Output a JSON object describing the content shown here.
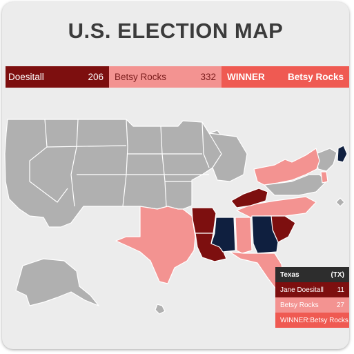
{
  "title": "U.S. ELECTION MAP",
  "colors": {
    "jane": "#7d0f0f",
    "betsy": "#f39391",
    "winner": "#ef5a52",
    "other": "#0f1f3f",
    "uncalled": "#b0b0b0"
  },
  "summary": {
    "jane_name": "Doesitall",
    "jane_votes": "206",
    "betsy_name": "Betsy Rocks",
    "betsy_votes": "332",
    "winner_label": "WINNER",
    "winner_name": "Betsy Rocks"
  },
  "tooltip": {
    "state": "Texas",
    "abbr": "(TX)",
    "jane_label": "Jane Doesitall",
    "jane_votes": "11",
    "betsy_label": "Betsy Rocks",
    "betsy_votes": "27",
    "winner_label": "WINNER:",
    "winner_name": "Betsy Rocks"
  }
}
